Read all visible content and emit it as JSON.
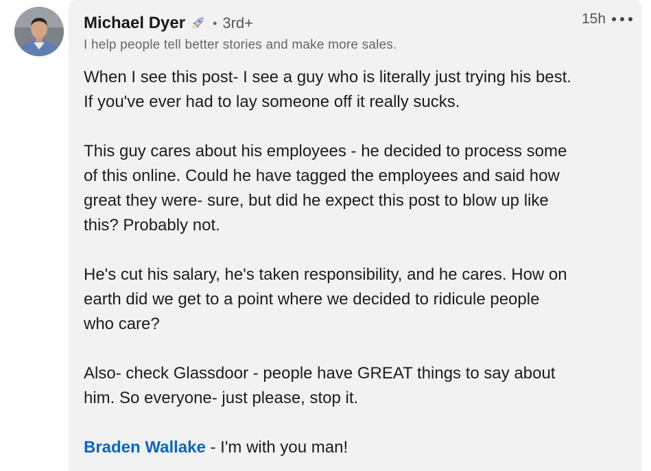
{
  "comment": {
    "author": {
      "name": "Michael Dyer",
      "badge_icon": "rocket-icon",
      "degree": "3rd+",
      "headline": "I help people tell better stories and make more sales."
    },
    "timestamp": "15h",
    "more_icon": "ellipsis-icon",
    "body": {
      "p1": [
        "When I see this post- I see a guy who is literally just trying his best.",
        "If you've ever had to lay someone off it really sucks."
      ],
      "p2": [
        "This guy cares about his employees - he decided to process some",
        "of this online. Could he have tagged the employees and said how",
        "great they were- sure, but did he expect this post to blow up like",
        "this? Probably not."
      ],
      "p3": [
        "He's cut his salary, he's taken responsibility, and he cares. How on",
        "earth did we get to a point where we decided to ridicule people",
        "who care?"
      ],
      "p4": [
        "Also- check Glassdoor - people have GREAT things to say about",
        "him. So everyone- just please, stop it."
      ],
      "mention_name": "Braden Wallake",
      "mention_rest": " - I'm with you man!"
    }
  },
  "colors": {
    "bubble": "#f2f2f2",
    "mention": "#0a66c2",
    "text": "#1c1c1c",
    "muted": "#666666"
  }
}
